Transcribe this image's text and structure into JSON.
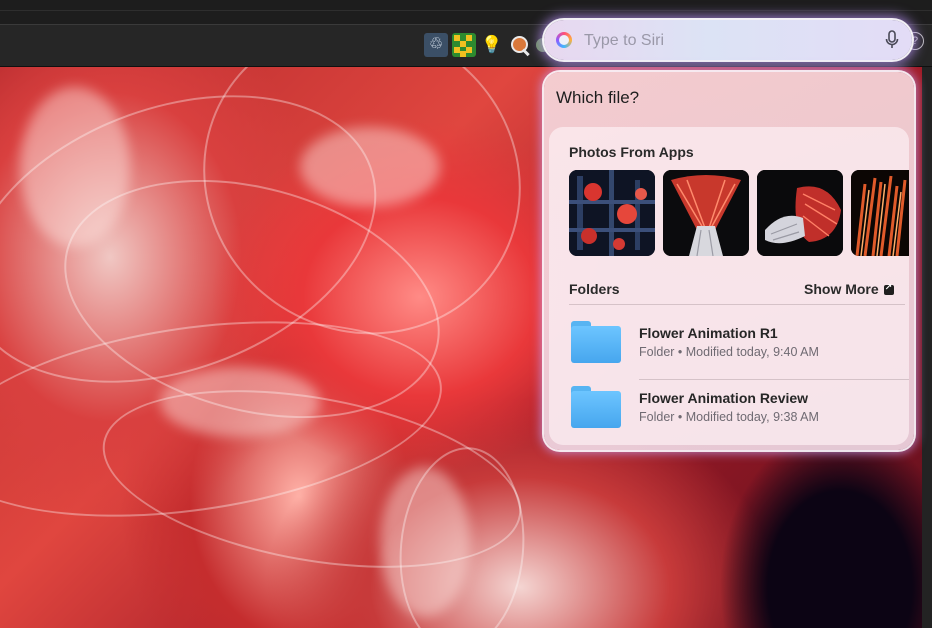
{
  "toolbar": {
    "icons": [
      "recycle-icon",
      "grid-app-icon",
      "lightbulb-icon",
      "zoom-icon",
      "status-icon",
      "help-icon"
    ],
    "help_glyph": "?"
  },
  "siri": {
    "placeholder": "Type to Siri",
    "accent_colors": [
      "#ff4f7b",
      "#ffb13b",
      "#3fb8ff",
      "#8f5bff"
    ]
  },
  "panel": {
    "title": "Which file?",
    "photos": {
      "title": "Photos From Apps",
      "thumbnails": [
        "photo-thumb-1",
        "photo-thumb-2",
        "photo-thumb-3",
        "photo-thumb-4"
      ]
    },
    "folders": {
      "title": "Folders",
      "show_more": "Show More",
      "items": [
        {
          "name": "Flower Animation R1",
          "meta": "Folder • Modified today, 9:40 AM"
        },
        {
          "name": "Flower Animation Review",
          "meta": "Folder • Modified today, 9:38 AM"
        }
      ]
    }
  },
  "colors": {
    "folder_blue": "#57b4f2",
    "glow": "#be96ff",
    "artwork_red": "#e0463f"
  }
}
